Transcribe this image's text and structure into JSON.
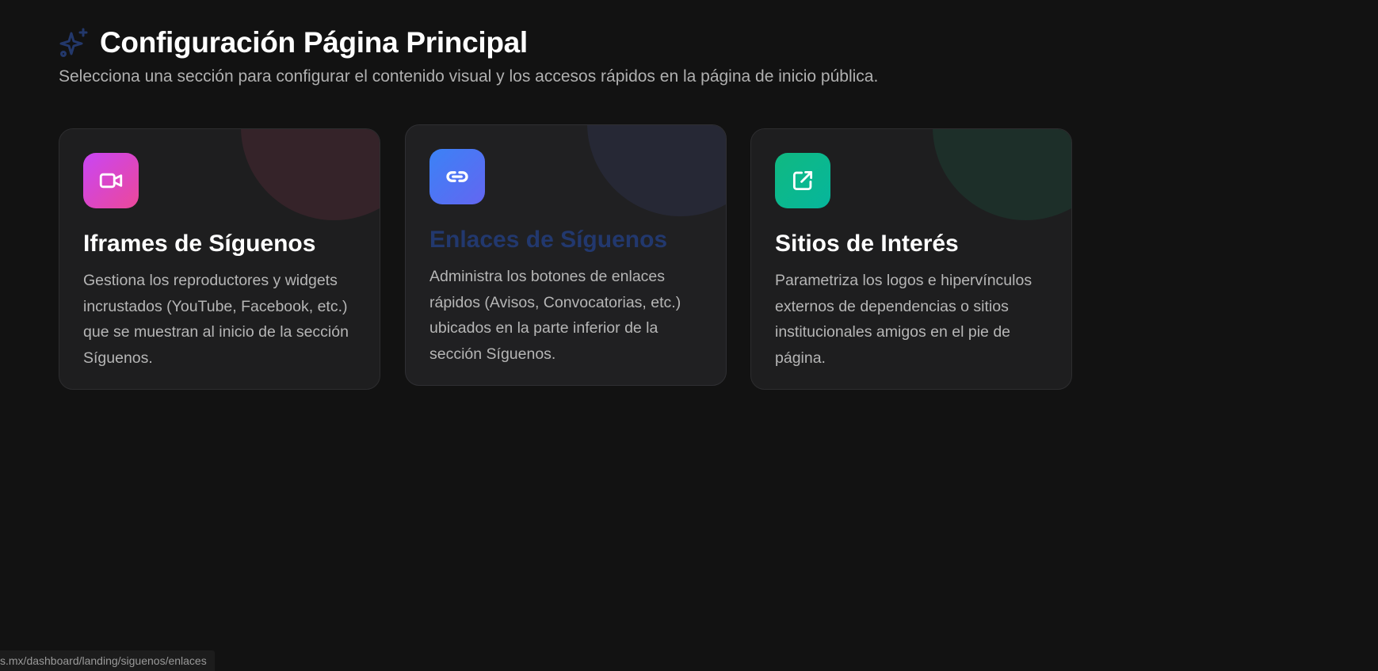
{
  "header": {
    "title": "Configuración Página Principal",
    "subtitle": "Selecciona una sección para configurar el contenido visual y los accesos rápidos en la página de inicio pública.",
    "icon": "sparkles-icon"
  },
  "cards": [
    {
      "title": "Iframes de Síguenos",
      "description": "Gestiona los reproductores y widgets incrustados (YouTube, Facebook, etc.) que se muestran al inicio de la sección Síguenos.",
      "icon": "video-icon",
      "accent": "#d946ef"
    },
    {
      "title": "Enlaces de Síguenos",
      "description": "Administra los botones de enlaces rápidos (Avisos, Convocatorias, etc.) ubicados en la parte inferior de la sección Síguenos.",
      "icon": "link-icon",
      "accent": "#4f6ef7"
    },
    {
      "title": "Sitios de Interés",
      "description": "Parametriza los logos e hipervínculos externos de dependencias o sitios institucionales amigos en el pie de página.",
      "icon": "external-link-icon",
      "accent": "#10b981"
    }
  ],
  "status_bar": {
    "url": "s.mx/dashboard/landing/siguenos/enlaces"
  }
}
